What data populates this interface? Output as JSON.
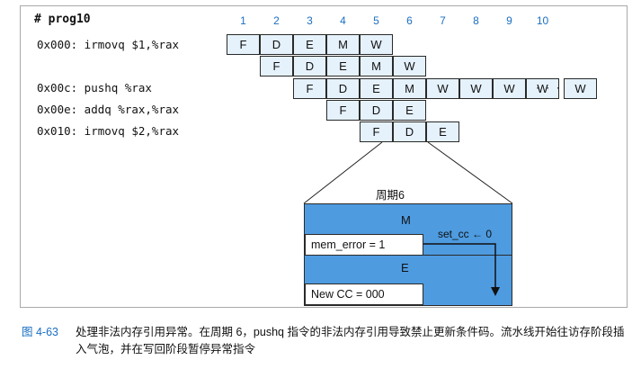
{
  "program": {
    "title": "# prog10",
    "instructions": [
      "0x000: irmovq $1,%rax",
      "0x00c: pushq %rax",
      "0x00e: addq %rax,%rax",
      "0x010: irmovq $2,%rax"
    ]
  },
  "cycles": [
    "1",
    "2",
    "3",
    "4",
    "5",
    "6",
    "7",
    "8",
    "9",
    "10"
  ],
  "pipeline": {
    "rows": [
      [
        "F",
        "D",
        "E",
        "M",
        "W"
      ],
      [
        "F",
        "D",
        "E",
        "M",
        "W"
      ],
      [
        "F",
        "D",
        "E",
        "M",
        "W",
        "W",
        "W",
        "W"
      ],
      [
        "F",
        "D",
        "E"
      ],
      [
        "F",
        "D",
        "E"
      ]
    ],
    "ellipsis": "· · ·",
    "final_stage": "W"
  },
  "cycle6": {
    "title": "周期6",
    "m_label": "M",
    "mem_error": "mem_error = 1",
    "set_cc": "set_cc ← 0",
    "e_label": "E",
    "new_cc": "New CC = 000"
  },
  "caption": {
    "number": "图 4-63",
    "text": "处理非法内存引用异常。在周期 6，pushq 指令的非法内存引用导致禁止更新条件码。流水线开始往访存阶段插入气泡，并在写回阶段暂停异常指令"
  },
  "colors": {
    "stage_fill": "#e5f1fb",
    "panel_fill": "#4e9be0",
    "cycle_number": "#1a6fc2"
  }
}
